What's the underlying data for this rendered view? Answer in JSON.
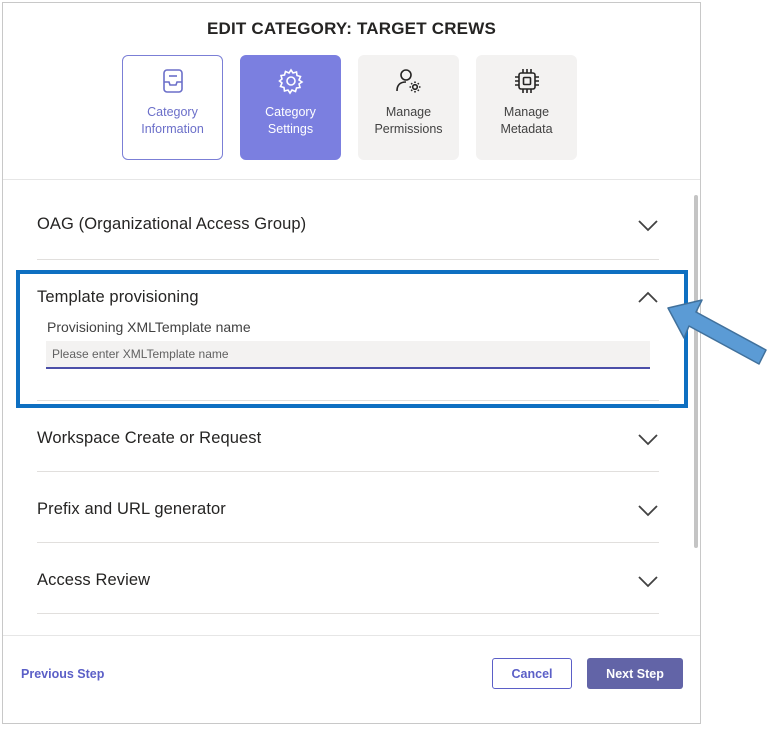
{
  "dialog": {
    "title": "EDIT CATEGORY: TARGET CREWS"
  },
  "steps": [
    {
      "label": "Category\nInformation",
      "icon": "clipboard-icon",
      "state": "done"
    },
    {
      "label": "Category\nSettings",
      "icon": "settings-cog-icon",
      "state": "active"
    },
    {
      "label": "Manage\nPermissions",
      "icon": "person-gear-icon",
      "state": "todo"
    },
    {
      "label": "Manage\nMetadata",
      "icon": "chip-icon",
      "state": "todo"
    }
  ],
  "sections": [
    {
      "title": "OAG (Organizational Access Group)",
      "expanded": false
    },
    {
      "title": "Template provisioning",
      "expanded": true,
      "field_label": "Provisioning XMLTemplate name",
      "field_placeholder": "Please enter XMLTemplate name",
      "field_value": ""
    },
    {
      "title": "Workspace Create or Request",
      "expanded": false
    },
    {
      "title": "Prefix and URL generator",
      "expanded": false
    },
    {
      "title": "Access Review",
      "expanded": false
    }
  ],
  "footer": {
    "previous_label": "Previous Step",
    "cancel_label": "Cancel",
    "next_label": "Next Step"
  },
  "colors": {
    "accent": "#6264a7",
    "active_step": "#7b7fe0",
    "highlight_border": "#0e6fc1",
    "arrow": "#5b9bd5"
  }
}
